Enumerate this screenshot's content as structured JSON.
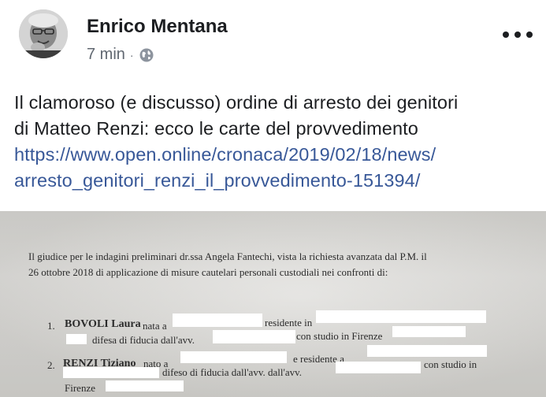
{
  "post": {
    "author": "Enrico Mentana",
    "time": "7 min",
    "separator": "·",
    "text_line1": "Il clamoroso (e discusso) ordine di arresto dei genitori",
    "text_line2": "di Matteo Renzi: ecco le carte del provvedimento",
    "link_line1": "https://www.open.online/cronaca/2019/02/18/news/",
    "link_line2": "arresto_genitori_renzi_il_provvedimento-151394/"
  },
  "icons": {
    "privacy": "globe-icon",
    "menu": "more-options-icon",
    "avatar": "profile-photo"
  },
  "document": {
    "line1": "Il giudice per le indagini preliminari dr.ssa Angela Fantechi, vista la richiesta avanzata dal P.M. il",
    "line2": "26 ottobre 2018 di applicazione di  misure cautelari personali custodiali nei confronti di:",
    "item1_num": "1.",
    "item1_a": "BOVOLI Laura",
    "item1_b": "nata a",
    "item1_c": "residente in",
    "item1_d": "difesa di fiducia dall'avv.",
    "item1_e": "con studio in Firenze",
    "item2_num": "2.",
    "item2_a": "RENZI Tiziano",
    "item2_b": "nato a",
    "item2_c": "e residente a",
    "item2_d": "difeso di fiducia dall'avv. dall'avv.",
    "item2_e": "con studio in",
    "item2_f": "Firenze"
  },
  "colors": {
    "text": "#1c1e21",
    "secondary": "#606770",
    "link": "#385898",
    "paper": "#dcdbd7"
  }
}
